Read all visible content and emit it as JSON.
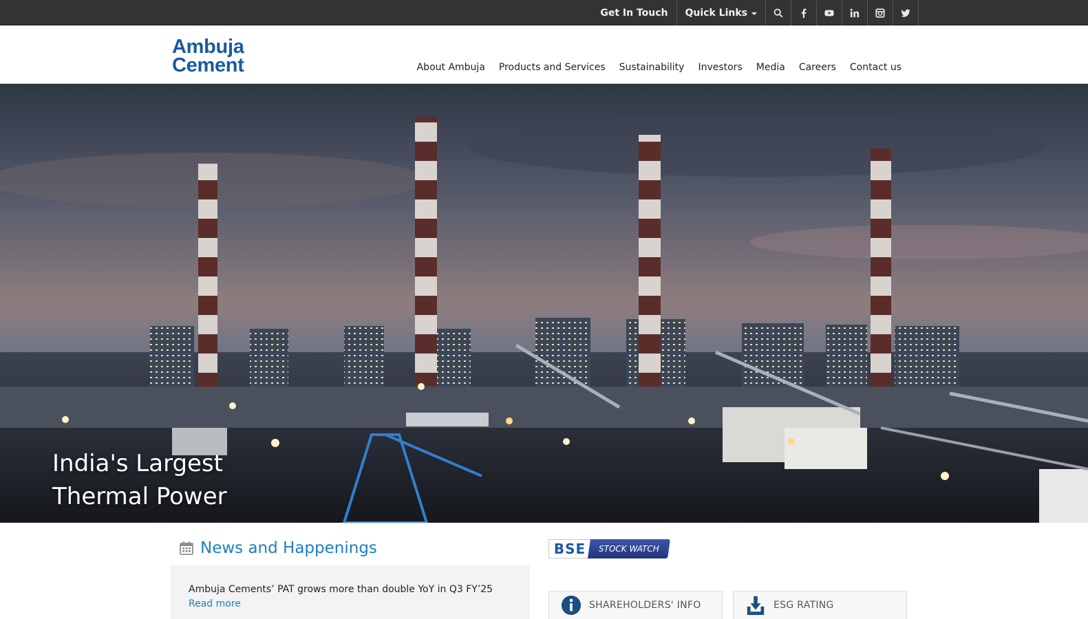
{
  "topbar": {
    "get_in_touch": "Get In Touch",
    "quick_links": "Quick Links",
    "icons": [
      "search-icon",
      "facebook-icon",
      "youtube-icon",
      "linkedin-icon",
      "instagram-icon",
      "twitter-icon"
    ]
  },
  "header": {
    "logo_line1": "Ambuja",
    "logo_line2": "Cement",
    "nav": [
      "About Ambuja",
      "Products and Services",
      "Sustainability",
      "Investors",
      "Media",
      "Careers",
      "Contact us"
    ]
  },
  "hero": {
    "caption_line1": "India's Largest",
    "caption_line2": "Thermal Power"
  },
  "news": {
    "title": "News and Happenings",
    "item_text": "Ambuja Cements’ PAT grows more than double YoY in Q3 FY’25",
    "read_more": "Read more"
  },
  "bse": {
    "left": "BSE",
    "right": "STOCK WATCH"
  },
  "cards": {
    "shareholders": "SHAREHOLDERS' INFO",
    "esg": "ESG RATING"
  },
  "colors": {
    "topbar_bg": "#333333",
    "brand_blue": "#1b5aa0",
    "link_blue": "#1c7fc1"
  }
}
